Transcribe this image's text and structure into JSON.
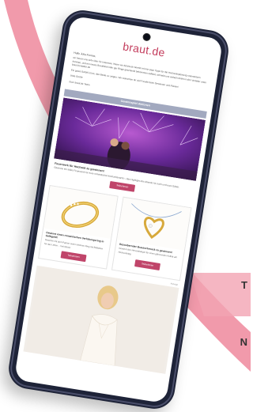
{
  "page": {
    "corner_letters": [
      "T",
      "N"
    ],
    "accent_color": "#e57f94"
  },
  "email": {
    "logo": "braut.de",
    "greeting": "Hallo Julia Kronas,",
    "paragraph_1": "wir freuen uns sehr über Ihr Interesse. Wenn wir dich/euch bereits mit ein paar Tipps für die Hochzeitsplanung unterstützen konnten, und ein neues Brautkleid oder gar Ringe geschenkt bekommen solltest, schreibt uns einfach direkt in den Verteiler unter braut-kontakte.de",
    "paragraph_2": "Ein gutes Gefühl ist es, das Beste zu zeigen. Wir wünschen dir viel Freude beim Gewinnen und Planen!",
    "sign_off": "Viele Grüße",
    "signature": "Euer braut.de Team",
    "section_title": "Gewinnspiel-Aktionen"
  },
  "feature": {
    "title": "Feuerwerk für Hochzeit zu gewinnen!",
    "text": "Gewinne ein tolles Feuerwerk für eure romantische Hochzeitsnacht – das Highlight des Abends für euch und eure Gäste.",
    "button_label": "Teilnehmen"
  },
  "cards": [
    {
      "title": "Gewinnt einen romantischen Verlobungsring in Gelbgold!",
      "text": "Gewinne mit dem Partner einen schönen Ring mit Brillanten für das Leben – Viel Glück!",
      "button_label": "Teilnehmen"
    },
    {
      "title": "Bezaubernder Brautschmuck zu gewinnen!",
      "text": "Gewinnt den Herzanhänger für einen glänzenden Auftritt am Hochzeitstag.",
      "button_label": "Teilnehmen"
    }
  ],
  "footnote": "Anzeige"
}
